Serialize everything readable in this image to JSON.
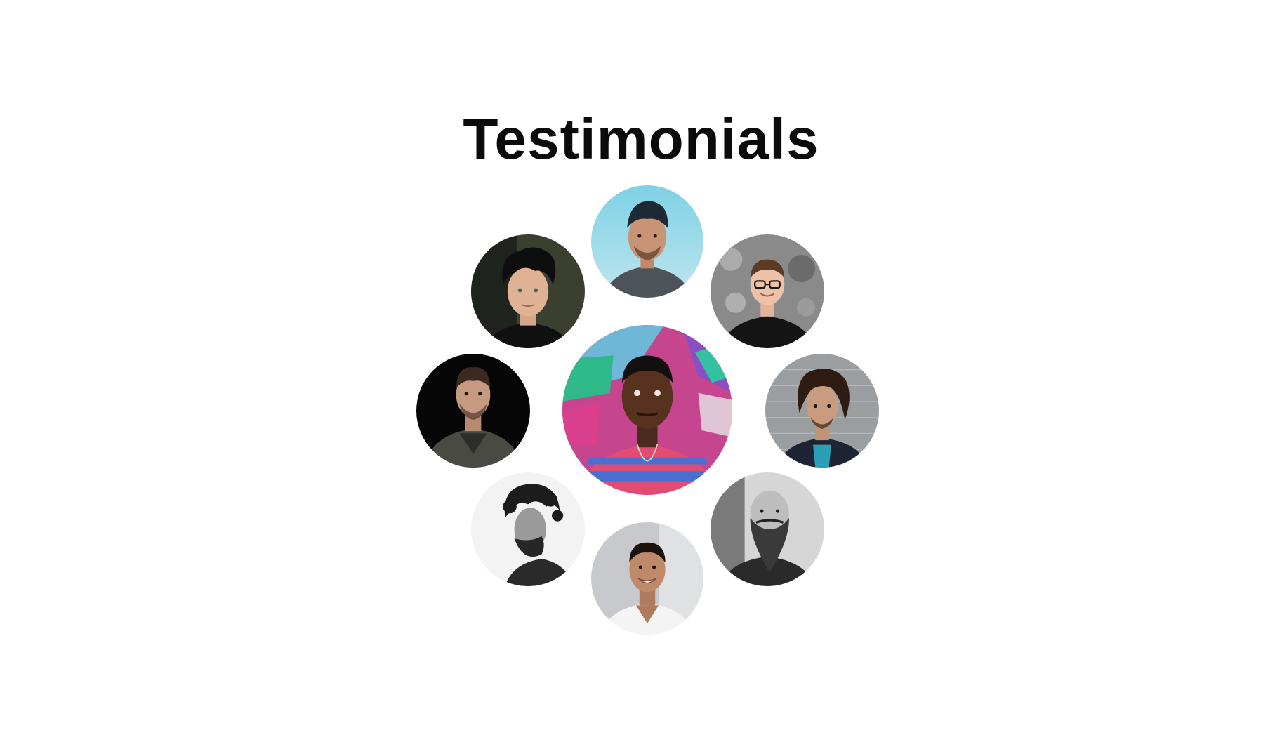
{
  "section": {
    "title": "Testimonials"
  },
  "avatars": [
    {
      "id": "top",
      "icon": "person-avatar-photo"
    },
    {
      "id": "upper-left",
      "icon": "person-avatar-photo"
    },
    {
      "id": "upper-right",
      "icon": "person-avatar-photo"
    },
    {
      "id": "left",
      "icon": "person-avatar-photo"
    },
    {
      "id": "center",
      "icon": "person-avatar-photo",
      "selected": true
    },
    {
      "id": "right",
      "icon": "person-avatar-photo"
    },
    {
      "id": "lower-left",
      "icon": "person-avatar-photo"
    },
    {
      "id": "lower-right",
      "icon": "person-avatar-photo"
    },
    {
      "id": "bottom",
      "icon": "person-avatar-photo"
    }
  ],
  "colors": {
    "background": "#ffffff",
    "title": "#0b0b0b"
  }
}
